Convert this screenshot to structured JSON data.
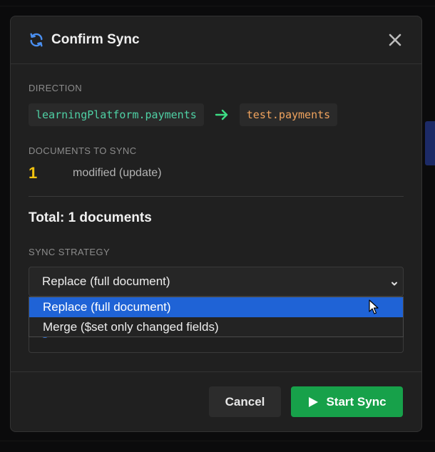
{
  "dialog": {
    "title": "Confirm Sync",
    "close_label": "×"
  },
  "direction": {
    "label": "DIRECTION",
    "source": "learningPlatform.payments",
    "target": "test.payments"
  },
  "documents": {
    "label": "DOCUMENTS TO SYNC",
    "count": "1",
    "description": "modified (update)"
  },
  "total": "Total: 1 documents",
  "strategy": {
    "label": "SYNC STRATEGY",
    "selected": "Replace (full document)",
    "options": [
      "Replace (full document)",
      "Merge ($set only changed fields)"
    ]
  },
  "footer": {
    "cancel": "Cancel",
    "start": "Start Sync"
  },
  "colors": {
    "accent_blue": "#1f63d6",
    "start_green": "#17a14a",
    "source_text": "#4fd1a5",
    "target_text": "#f0a35e",
    "count_yellow": "#f2c30f"
  },
  "icons": {
    "title": "sync-icon",
    "close": "close-icon",
    "arrow": "arrow-right-icon",
    "select": "chevron-down-icon",
    "start": "play-icon",
    "pointer": "mouse-cursor-icon"
  }
}
